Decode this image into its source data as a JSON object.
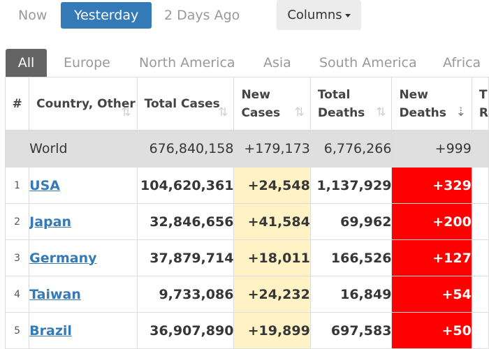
{
  "day_tabs": [
    {
      "label": "Now",
      "active": false
    },
    {
      "label": "Yesterday",
      "active": true
    },
    {
      "label": "2 Days Ago",
      "active": false
    }
  ],
  "columns_button": {
    "label": "Columns"
  },
  "region_tabs": [
    {
      "label": "All",
      "active": true
    },
    {
      "label": "Europe",
      "active": false
    },
    {
      "label": "North America",
      "active": false
    },
    {
      "label": "Asia",
      "active": false
    },
    {
      "label": "South America",
      "active": false
    },
    {
      "label": "Africa",
      "active": false
    }
  ],
  "table": {
    "headers": {
      "index": "#",
      "country": "Country, Other",
      "total_cases": "Total Cases",
      "new_cases": "New Cases",
      "total_deaths": "Total Deaths",
      "new_deaths": "New Deaths",
      "partial": "T R"
    },
    "world": {
      "country": "World",
      "total_cases": "676,840,158",
      "new_cases": "+179,173",
      "total_deaths": "6,776,266",
      "new_deaths": "+999"
    },
    "rows": [
      {
        "index": "1",
        "country": "USA",
        "total_cases": "104,620,361",
        "new_cases": "+24,548",
        "total_deaths": "1,137,929",
        "new_deaths": "+329"
      },
      {
        "index": "2",
        "country": "Japan",
        "total_cases": "32,846,656",
        "new_cases": "+41,584",
        "total_deaths": "69,962",
        "new_deaths": "+200"
      },
      {
        "index": "3",
        "country": "Germany",
        "total_cases": "37,879,714",
        "new_cases": "+18,011",
        "total_deaths": "166,526",
        "new_deaths": "+127"
      },
      {
        "index": "4",
        "country": "Taiwan",
        "total_cases": "9,733,086",
        "new_cases": "+24,232",
        "total_deaths": "16,849",
        "new_deaths": "+54"
      },
      {
        "index": "5",
        "country": "Brazil",
        "total_cases": "36,907,890",
        "new_cases": "+19,899",
        "total_deaths": "697,583",
        "new_deaths": "+50"
      }
    ]
  },
  "colors": {
    "active_day_tab": "#337ab7",
    "active_region_tab": "#646464",
    "new_cases_bg": "#fff3c6",
    "new_deaths_bg": "#ff0000",
    "world_row_bg": "#dfdfdf"
  }
}
